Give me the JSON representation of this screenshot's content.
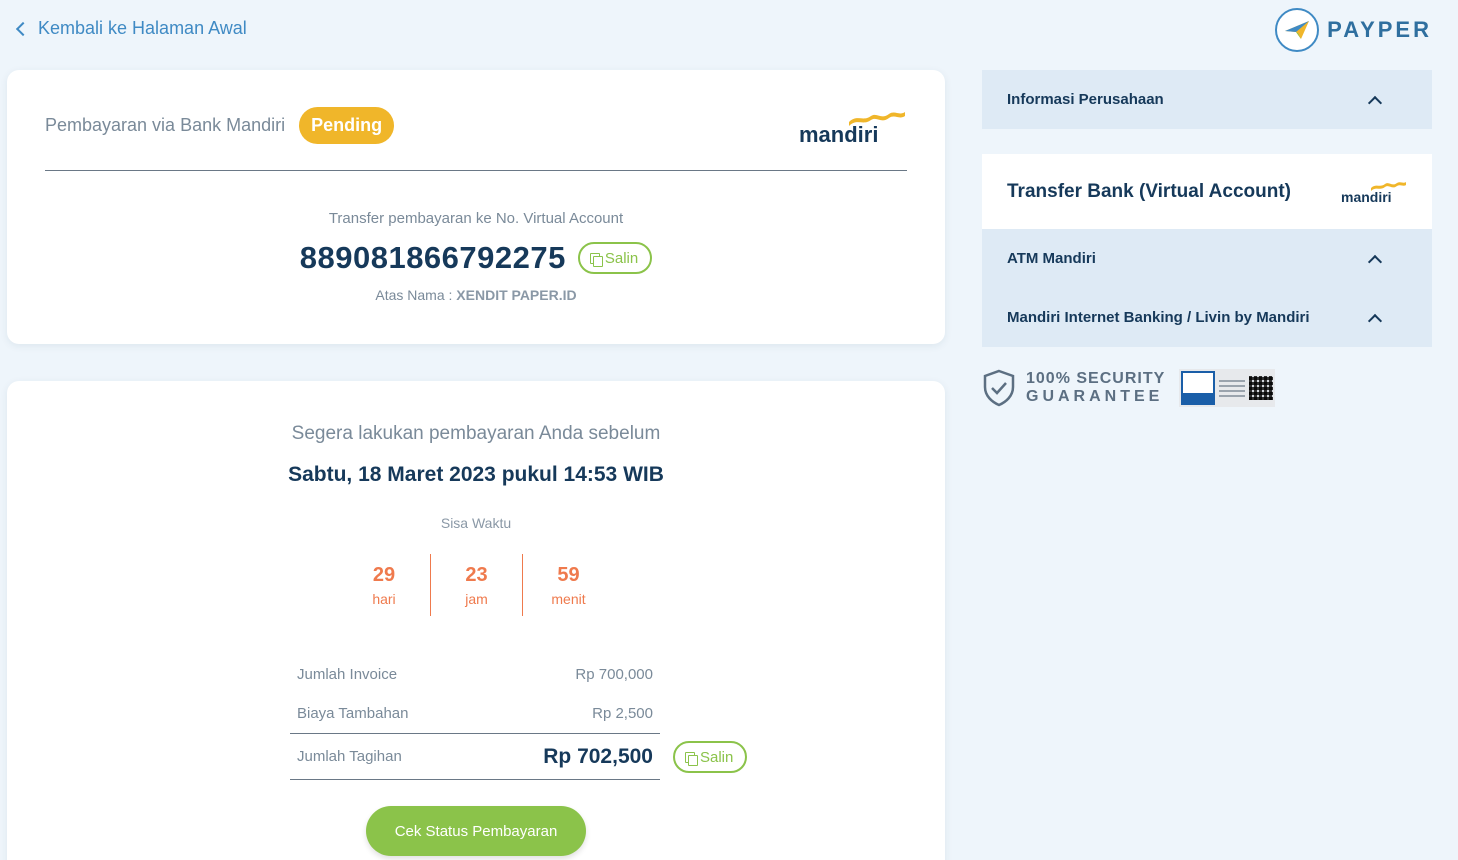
{
  "nav": {
    "back_label": "Kembali ke Halaman Awal"
  },
  "brand": {
    "name": "PAYPER"
  },
  "payment": {
    "title": "Pembayaran via Bank Mandiri",
    "status": "Pending",
    "bank_logo": "mandiri",
    "va_caption": "Transfer pembayaran ke No. Virtual Account",
    "va_number": "889081866792275",
    "copy_label": "Salin",
    "owner_label": "Atas Nama :",
    "owner_name": "XENDIT PAPER.ID"
  },
  "deadline": {
    "caption": "Segera lakukan pembayaran Anda sebelum",
    "datetime": "Sabtu, 18 Maret 2023 pukul 14:53 WIB",
    "remaining_label": "Sisa Waktu",
    "countdown": [
      {
        "value": "29",
        "unit": "hari"
      },
      {
        "value": "23",
        "unit": "jam"
      },
      {
        "value": "59",
        "unit": "menit"
      }
    ]
  },
  "summary": {
    "rows": [
      {
        "label": "Jumlah Invoice",
        "value": "Rp 700,000"
      },
      {
        "label": "Biaya Tambahan",
        "value": "Rp 2,500"
      },
      {
        "label": "Jumlah Tagihan",
        "value": "Rp 702,500"
      }
    ],
    "copy_label": "Salin",
    "check_button": "Cek Status Pembayaran"
  },
  "sidebar": {
    "company_info": "Informasi Perusahaan",
    "method_title": "Transfer Bank (Virtual Account)",
    "method_logo": "mandiri",
    "instructions": [
      {
        "label": "ATM Mandiri"
      },
      {
        "label": "Mandiri Internet Banking / Livin by Mandiri"
      }
    ]
  },
  "security": {
    "line1": "100% SECURITY",
    "line2": "GUARANTEE"
  },
  "colors": {
    "accent_green": "#8bc34a",
    "pending": "#f0b62a",
    "countdown": "#ef7a4d",
    "link_blue": "#3f8ac4",
    "text_dark": "#16395a"
  }
}
